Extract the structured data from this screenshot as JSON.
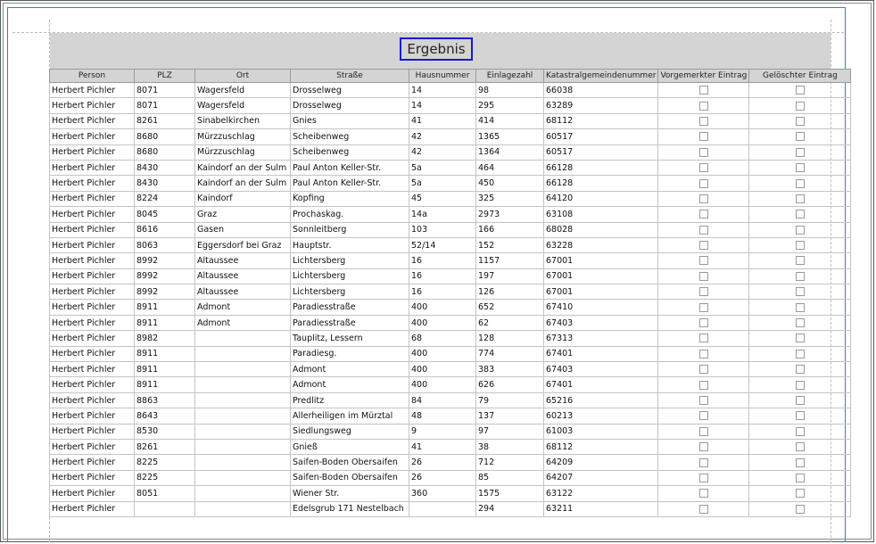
{
  "report": {
    "title": "Ergebnis",
    "columns": [
      "Person",
      "PLZ",
      "Ort",
      "Straße",
      "Hausnummer",
      "Einlagezahl",
      "Katastralgemeindenummer",
      "Vorgemerkter Eintrag",
      "Gelöschter Eintrag"
    ],
    "rows": [
      {
        "person": "Herbert Pichler",
        "plz": "8071",
        "ort": "Wagersfeld",
        "strasse": "Drosselweg",
        "hausnummer": "14",
        "einlagezahl": "98",
        "kg": "66038",
        "vorgemerkt": false,
        "geloescht": false
      },
      {
        "person": "Herbert Pichler",
        "plz": "8071",
        "ort": "Wagersfeld",
        "strasse": "Drosselweg",
        "hausnummer": "14",
        "einlagezahl": "295",
        "kg": "63289",
        "vorgemerkt": false,
        "geloescht": false
      },
      {
        "person": "Herbert Pichler",
        "plz": "8261",
        "ort": "Sinabelkirchen",
        "strasse": "Gnies",
        "hausnummer": "41",
        "einlagezahl": "414",
        "kg": "68112",
        "vorgemerkt": false,
        "geloescht": false
      },
      {
        "person": "Herbert Pichler",
        "plz": "8680",
        "ort": "Mürzzuschlag",
        "strasse": "Scheibenweg",
        "hausnummer": "42",
        "einlagezahl": "1365",
        "kg": "60517",
        "vorgemerkt": false,
        "geloescht": false
      },
      {
        "person": "Herbert Pichler",
        "plz": "8680",
        "ort": "Mürzzuschlag",
        "strasse": "Scheibenweg",
        "hausnummer": "42",
        "einlagezahl": "1364",
        "kg": "60517",
        "vorgemerkt": false,
        "geloescht": false
      },
      {
        "person": "Herbert Pichler",
        "plz": "8430",
        "ort": "Kaindorf an der Sulm",
        "strasse": "Paul Anton Keller-Str.",
        "hausnummer": "5a",
        "einlagezahl": "464",
        "kg": "66128",
        "vorgemerkt": false,
        "geloescht": false
      },
      {
        "person": "Herbert Pichler",
        "plz": "8430",
        "ort": "Kaindorf an der Sulm",
        "strasse": "Paul Anton Keller-Str.",
        "hausnummer": "5a",
        "einlagezahl": "450",
        "kg": "66128",
        "vorgemerkt": false,
        "geloescht": false
      },
      {
        "person": "Herbert Pichler",
        "plz": "8224",
        "ort": "Kaindorf",
        "strasse": "Kopfing",
        "hausnummer": "45",
        "einlagezahl": "325",
        "kg": "64120",
        "vorgemerkt": false,
        "geloescht": false
      },
      {
        "person": "Herbert Pichler",
        "plz": "8045",
        "ort": "Graz",
        "strasse": "Prochaskag.",
        "hausnummer": "14a",
        "einlagezahl": "2973",
        "kg": "63108",
        "vorgemerkt": false,
        "geloescht": false
      },
      {
        "person": "Herbert Pichler",
        "plz": "8616",
        "ort": "Gasen",
        "strasse": "Sonnleitberg",
        "hausnummer": "103",
        "einlagezahl": "166",
        "kg": "68028",
        "vorgemerkt": false,
        "geloescht": false
      },
      {
        "person": "Herbert Pichler",
        "plz": "8063",
        "ort": "Eggersdorf bei Graz",
        "strasse": "Hauptstr.",
        "hausnummer": "52/14",
        "einlagezahl": "152",
        "kg": "63228",
        "vorgemerkt": false,
        "geloescht": false
      },
      {
        "person": "Herbert Pichler",
        "plz": "8992",
        "ort": "Altaussee",
        "strasse": "Lichtersberg",
        "hausnummer": "16",
        "einlagezahl": "1157",
        "kg": "67001",
        "vorgemerkt": false,
        "geloescht": false
      },
      {
        "person": "Herbert Pichler",
        "plz": "8992",
        "ort": "Altaussee",
        "strasse": "Lichtersberg",
        "hausnummer": "16",
        "einlagezahl": "197",
        "kg": "67001",
        "vorgemerkt": false,
        "geloescht": false
      },
      {
        "person": "Herbert Pichler",
        "plz": "8992",
        "ort": "Altaussee",
        "strasse": "Lichtersberg",
        "hausnummer": "16",
        "einlagezahl": "126",
        "kg": "67001",
        "vorgemerkt": false,
        "geloescht": false
      },
      {
        "person": "Herbert Pichler",
        "plz": "8911",
        "ort": "Admont",
        "strasse": "Paradiesstraße",
        "hausnummer": "400",
        "einlagezahl": "652",
        "kg": "67410",
        "vorgemerkt": false,
        "geloescht": false
      },
      {
        "person": "Herbert Pichler",
        "plz": "8911",
        "ort": "Admont",
        "strasse": "Paradiesstraße",
        "hausnummer": "400",
        "einlagezahl": "62",
        "kg": "67403",
        "vorgemerkt": false,
        "geloescht": false
      },
      {
        "person": "Herbert Pichler",
        "plz": "8982",
        "ort": "",
        "strasse": "Tauplitz, Lessern",
        "hausnummer": "68",
        "einlagezahl": "128",
        "kg": "67313",
        "vorgemerkt": false,
        "geloescht": false
      },
      {
        "person": "Herbert Pichler",
        "plz": "8911",
        "ort": "",
        "strasse": "Paradiesg.",
        "hausnummer": "400",
        "einlagezahl": "774",
        "kg": "67401",
        "vorgemerkt": false,
        "geloescht": false
      },
      {
        "person": "Herbert Pichler",
        "plz": "8911",
        "ort": "",
        "strasse": "Admont",
        "hausnummer": "400",
        "einlagezahl": "383",
        "kg": "67403",
        "vorgemerkt": false,
        "geloescht": false
      },
      {
        "person": "Herbert Pichler",
        "plz": "8911",
        "ort": "",
        "strasse": "Admont",
        "hausnummer": "400",
        "einlagezahl": "626",
        "kg": "67401",
        "vorgemerkt": false,
        "geloescht": false
      },
      {
        "person": "Herbert Pichler",
        "plz": "8863",
        "ort": "",
        "strasse": "Predlitz",
        "hausnummer": "84",
        "einlagezahl": "79",
        "kg": "65216",
        "vorgemerkt": false,
        "geloescht": false
      },
      {
        "person": "Herbert Pichler",
        "plz": "8643",
        "ort": "",
        "strasse": "Allerheiligen im Mürztal",
        "hausnummer": "48",
        "einlagezahl": "137",
        "kg": "60213",
        "vorgemerkt": false,
        "geloescht": false
      },
      {
        "person": "Herbert Pichler",
        "plz": "8530",
        "ort": "",
        "strasse": "Siedlungsweg",
        "hausnummer": "9",
        "einlagezahl": "97",
        "kg": "61003",
        "vorgemerkt": false,
        "geloescht": false
      },
      {
        "person": "Herbert Pichler",
        "plz": "8261",
        "ort": "",
        "strasse": "Gnieß",
        "hausnummer": "41",
        "einlagezahl": "38",
        "kg": "68112",
        "vorgemerkt": false,
        "geloescht": false
      },
      {
        "person": "Herbert Pichler",
        "plz": "8225",
        "ort": "",
        "strasse": "Saifen-Boden Obersaifen",
        "hausnummer": "26",
        "einlagezahl": "712",
        "kg": "64209",
        "vorgemerkt": false,
        "geloescht": false
      },
      {
        "person": "Herbert Pichler",
        "plz": "8225",
        "ort": "",
        "strasse": "Saifen-Boden Obersaifen",
        "hausnummer": "26",
        "einlagezahl": "85",
        "kg": "64207",
        "vorgemerkt": false,
        "geloescht": false
      },
      {
        "person": "Herbert Pichler",
        "plz": "8051",
        "ort": "",
        "strasse": "Wiener Str.",
        "hausnummer": "360",
        "einlagezahl": "1575",
        "kg": "63122",
        "vorgemerkt": false,
        "geloescht": false
      },
      {
        "person": "Herbert Pichler",
        "plz": "",
        "ort": "",
        "strasse": "Edelsgrub 171 Nestelbach",
        "hausnummer": "",
        "einlagezahl": "294",
        "kg": "63211",
        "vorgemerkt": false,
        "geloescht": false
      }
    ]
  },
  "colors": {
    "header_band": "#d4d4d4",
    "title_border": "#1818d8",
    "frame_accent": "#2a8f9f"
  }
}
